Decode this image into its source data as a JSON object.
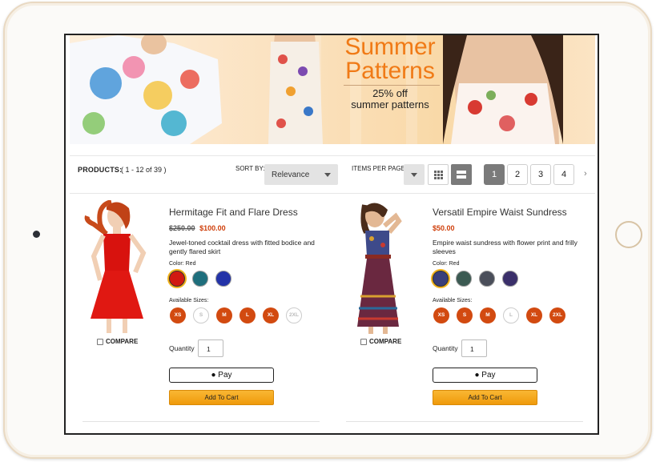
{
  "banner": {
    "title_line1": "Summer",
    "title_line2": "Patterns",
    "offer": "25% off",
    "subtitle": "summer patterns"
  },
  "toolbar": {
    "products_label": "PRODUCTS:",
    "products_count": "( 1 - 12 of 39 )",
    "sort_label": "SORT BY:",
    "sort_value": "Relevance",
    "items_per_page_label": "ITEMS PER PAGE:",
    "pages": [
      "1",
      "2",
      "3",
      "4"
    ],
    "active_page": "1",
    "next_symbol": "›"
  },
  "products": [
    {
      "name": "Hermitage Fit and Flare Dress",
      "old_price": "$250.00",
      "price": "$100.00",
      "description": "Jewel-toned cocktail dress with fitted bodice and gently flared skirt",
      "color_label": "Color: Red",
      "swatch_colors": [
        "#d11a12",
        "#1e6e7c",
        "#2333a8"
      ],
      "sizes_label": "Available Sizes:",
      "sizes": [
        {
          "label": "XS",
          "available": true
        },
        {
          "label": "S",
          "available": false
        },
        {
          "label": "M",
          "available": true
        },
        {
          "label": "L",
          "available": true
        },
        {
          "label": "XL",
          "available": true
        },
        {
          "label": "2XL",
          "available": false
        }
      ],
      "compare_label": "COMPARE",
      "quantity_label": "Quantity",
      "quantity": "1",
      "applepay_label": " Pay",
      "add_to_cart_label": "Add To Cart"
    },
    {
      "name": "Versatil Empire Waist Sundress",
      "old_price": "",
      "price": "$50.00",
      "description": "Empire waist sundress with flower print and frilly sleeves",
      "color_label": "Color: Red",
      "swatch_colors": [
        "#3a3f7a",
        "#3b5a52",
        "#4a4e5a",
        "#3a2f6a"
      ],
      "sizes_label": "Available Sizes:",
      "sizes": [
        {
          "label": "XS",
          "available": true
        },
        {
          "label": "S",
          "available": true
        },
        {
          "label": "M",
          "available": true
        },
        {
          "label": "L",
          "available": false
        },
        {
          "label": "XL",
          "available": true
        },
        {
          "label": "2XL",
          "available": true
        }
      ],
      "compare_label": "COMPARE",
      "quantity_label": "Quantity",
      "quantity": "1",
      "applepay_label": " Pay",
      "add_to_cart_label": "Add To Cart"
    }
  ]
}
